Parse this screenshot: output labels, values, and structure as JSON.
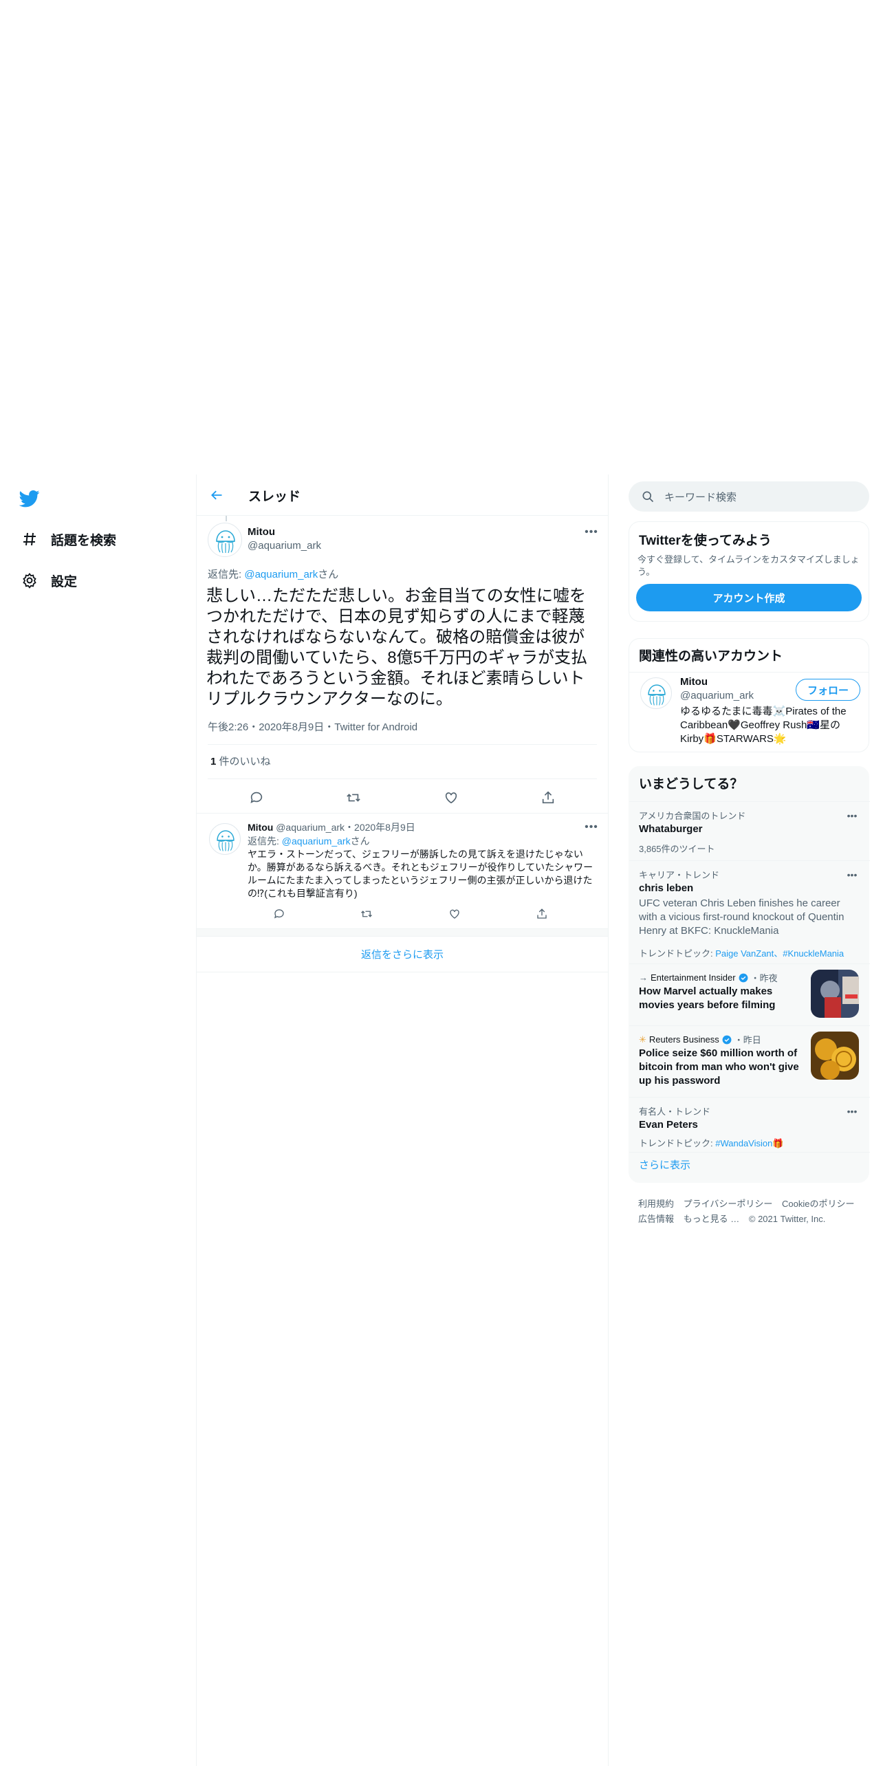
{
  "nav": {
    "items": [
      {
        "label": "話題を検索",
        "icon": "hashtag-icon"
      },
      {
        "label": "設定",
        "icon": "gear-icon"
      }
    ]
  },
  "header": {
    "title": "スレッド"
  },
  "main_tweet": {
    "name": "Mitou",
    "handle": "@aquarium_ark",
    "reply_prefix": "返信先: ",
    "reply_handle": "@aquarium_ark",
    "reply_suffix": "さん",
    "text": "悲しい…ただただ悲しい。お金目当ての女性に嘘をつかれただけで、日本の見ず知らずの人にまで軽蔑されなければならないなんて。破格の賠償金は彼が裁判の間働いていたら、8億5千万円のギャラが支払われたであろうという金額。それほど素晴らしいトリプルクラウンアクターなのに。",
    "meta": "午後2:26・2020年8月9日・Twitter for Android",
    "likes_count": "1",
    "likes_label": " 件のいいね"
  },
  "reply_tweet": {
    "name": "Mitou",
    "handle_date": "@aquarium_ark・2020年8月9日",
    "reply_prefix": "返信先: ",
    "reply_handle": "@aquarium_ark",
    "reply_suffix": "さん",
    "text": "ヤエラ・ストーンだって、ジェフリーが勝訴したの見て訴えを退けたじゃないか。勝算があるなら訴えるべき。それともジェフリーが役作りしていたシャワールームにたまたま入ってしまったというジェフリー側の主張が正しいから退けたの⁉(これも目撃証言有り)"
  },
  "show_more_replies": "返信をさらに表示",
  "search": {
    "placeholder": "キーワード検索"
  },
  "signup": {
    "title": "Twitterを使ってみよう",
    "desc": "今すぐ登録して、タイムラインをカスタマイズしましょう。",
    "button": "アカウント作成"
  },
  "related": {
    "title": "関連性の高いアカウント",
    "name": "Mitou",
    "handle": "@aquarium_ark",
    "follow": "フォロー",
    "bio": "ゆるゆるたまに毒毒☠️Pirates of the Caribbean🖤Geoffrey Rush🇦🇺星のKirby🎁STARWARS🌟"
  },
  "trends": {
    "title": "いまどうしてる？",
    "items": [
      {
        "meta": "アメリカ合衆国のトレンド",
        "title": "Whataburger",
        "sub": "3,865件のツイート"
      },
      {
        "meta": "キャリア・トレンド",
        "title": "chris leben",
        "desc": "UFC veteran Chris Leben finishes he career with a vicious first-round knockout of Quentin Henry at BKFC: KnuckleMania",
        "topic_label": "トレンドトピック: ",
        "topic_links": "Paige VanZant、#KnuckleMania"
      },
      {
        "source": "Entertainment Insider",
        "time": "・昨夜",
        "title": "How Marvel actually makes movies years before filming"
      },
      {
        "source": "Reuters Business",
        "time": "・昨日",
        "title": "Police seize $60 million worth of bitcoin from man who won't give up his password"
      },
      {
        "meta": "有名人・トレンド",
        "title": "Evan Peters",
        "topic_label": "トレンドトピック: ",
        "topic_links": "#WandaVision🎁"
      }
    ],
    "show_more": "さらに表示"
  },
  "footer": {
    "links": [
      "利用規約",
      "プライバシーポリシー",
      "Cookieのポリシー",
      "広告情報",
      "もっと見る …",
      "© 2021 Twitter, Inc."
    ]
  },
  "colors": {
    "accent": "#1d9bf0",
    "text": "#0f1419",
    "muted": "#536471",
    "border": "#eff3f4"
  }
}
